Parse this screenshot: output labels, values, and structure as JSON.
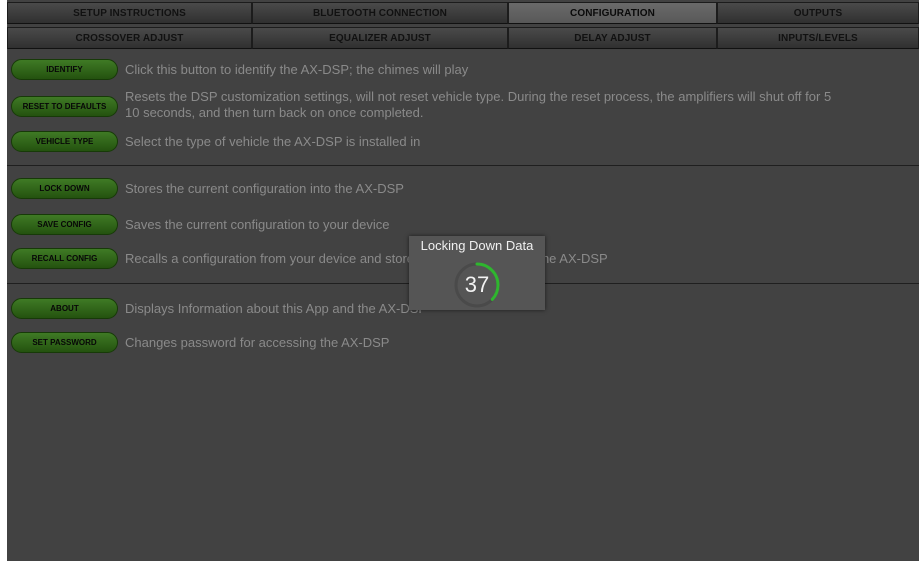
{
  "tabs_row1": [
    {
      "label": "SETUP INSTRUCTIONS",
      "active": false
    },
    {
      "label": "BLUETOOTH CONNECTION",
      "active": false
    },
    {
      "label": "CONFIGURATION",
      "active": true
    },
    {
      "label": "OUTPUTS",
      "active": false
    }
  ],
  "tabs_row2": [
    {
      "label": "CROSSOVER ADJUST"
    },
    {
      "label": "EQUALIZER ADJUST"
    },
    {
      "label": "DELAY ADJUST"
    },
    {
      "label": "INPUTS/LEVELS"
    }
  ],
  "items": [
    {
      "button": "IDENTIFY",
      "description": "Click this button to identify the AX-DSP; the chimes will play"
    },
    {
      "button": "RESET TO DEFAULTS",
      "description": "Resets the DSP customization settings, will not reset vehicle type. During the reset process, the amplifiers will shut off for 5",
      "description2": "10 seconds, and then turn back on once completed."
    },
    {
      "button": "VEHICLE TYPE",
      "description": "Select the type of vehicle the AX-DSP is installed in"
    },
    {
      "button": "LOCK DOWN",
      "description": "Stores the current configuration into the AX-DSP"
    },
    {
      "button": "SAVE CONFIG",
      "description": "Saves the current configuration to your device"
    },
    {
      "button": "RECALL CONFIG",
      "description": "Recalls a configuration from your device and stores the configuration to the AX-DSP"
    },
    {
      "button": "ABOUT",
      "description": "Displays Information about this App and the AX-DSP"
    },
    {
      "button": "SET PASSWORD",
      "description": "Changes password for accessing the AX-DSP"
    }
  ],
  "dialog": {
    "title": "Locking Down Data",
    "progress_value": "37",
    "progress_fraction": 0.37
  },
  "colors": {
    "accent_green": "#3f7a25",
    "progress_green": "#2fb52f",
    "background": "#424242"
  }
}
